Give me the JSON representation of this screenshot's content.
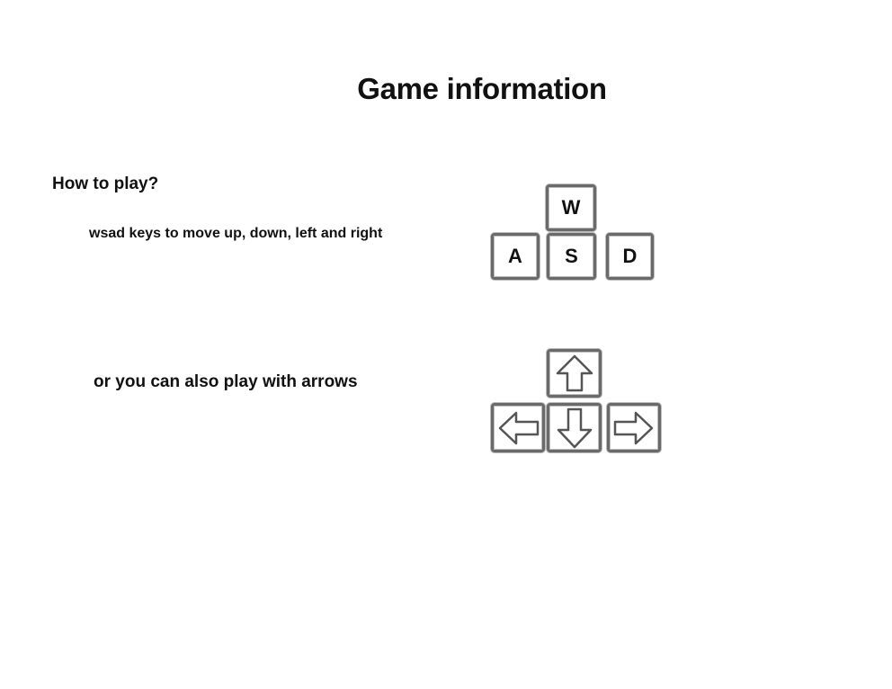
{
  "page": {
    "title": "Game information"
  },
  "how_to_play": {
    "heading": "How to play?",
    "wsad_text": "wsad keys to move up, down, left and right",
    "arrows_text": "or you can also play with arrows"
  },
  "keys": {
    "w": "W",
    "a": "A",
    "s": "S",
    "d": "D"
  },
  "arrow_keys": {
    "up_icon": "arrow-up-icon",
    "down_icon": "arrow-down-icon",
    "left_icon": "arrow-left-icon",
    "right_icon": "arrow-right-icon"
  },
  "colors": {
    "text": "#111111",
    "key_border": "#6a6a6a",
    "background": "#ffffff"
  }
}
